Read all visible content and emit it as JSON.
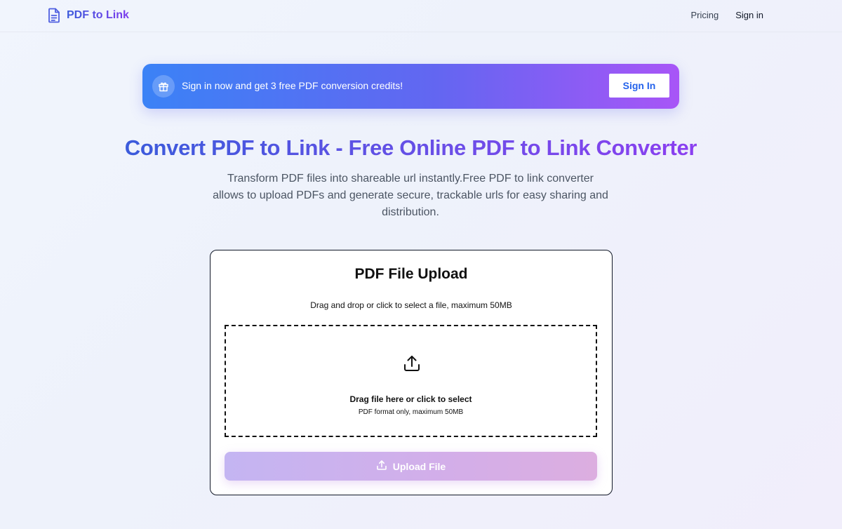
{
  "nav": {
    "brand": "PDF to Link",
    "brand_icon": "document-icon",
    "links": [
      {
        "label": "Pricing"
      },
      {
        "label": "Sign in"
      }
    ]
  },
  "banner": {
    "icon": "gift-icon",
    "text": "Sign in now and get 3 free PDF conversion credits!",
    "button_label": "Sign In"
  },
  "hero": {
    "title": "Convert PDF to Link - Free Online PDF to Link Converter",
    "subtitle": "Transform PDF files into shareable url instantly.Free PDF to link converter allows to upload PDFs and generate secure, trackable urls for easy sharing and distribution."
  },
  "upload_card": {
    "title": "PDF File Upload",
    "description": "Drag and drop or click to select a file, maximum 50MB",
    "dropzone_icon": "upload-icon",
    "dropzone_main": "Drag file here or click to select",
    "dropzone_sub": "PDF format only, maximum 50MB",
    "button_label": "Upload File",
    "button_icon": "upload-icon"
  },
  "colors": {
    "accent_blue": "#3b5bdb",
    "accent_purple": "#7c3aed",
    "banner_start": "#3b82f6",
    "banner_end": "#a855f7",
    "upload_button": "#d3aee9"
  }
}
